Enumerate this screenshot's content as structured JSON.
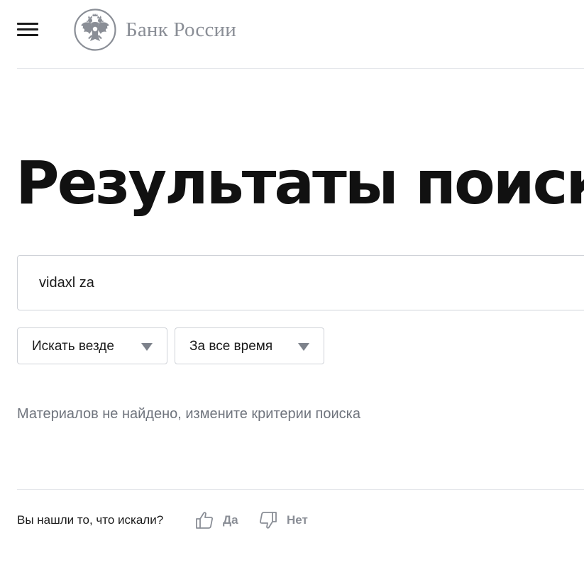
{
  "header": {
    "logo_text": "Банк России",
    "emblem_icon": "double-headed-eagle-icon",
    "menu_icon": "hamburger-menu-icon"
  },
  "main": {
    "title": "Результаты поиска",
    "search": {
      "value": "vidaxl za"
    },
    "filters": [
      {
        "label": "Искать везде",
        "icon": "triangle-down-icon"
      },
      {
        "label": "За все время",
        "icon": "triangle-down-icon"
      }
    ],
    "empty_message": "Материалов не найдено, измените критерии поиска"
  },
  "feedback": {
    "question": "Вы нашли то, что искали?",
    "yes_label": "Да",
    "no_label": "Нет",
    "yes_icon": "thumbs-up-icon",
    "no_icon": "thumbs-down-icon"
  },
  "colors": {
    "text": "#1a1a1a",
    "muted": "#8a8e96",
    "border": "#cfd2d8",
    "divider": "#e4e6ea"
  }
}
